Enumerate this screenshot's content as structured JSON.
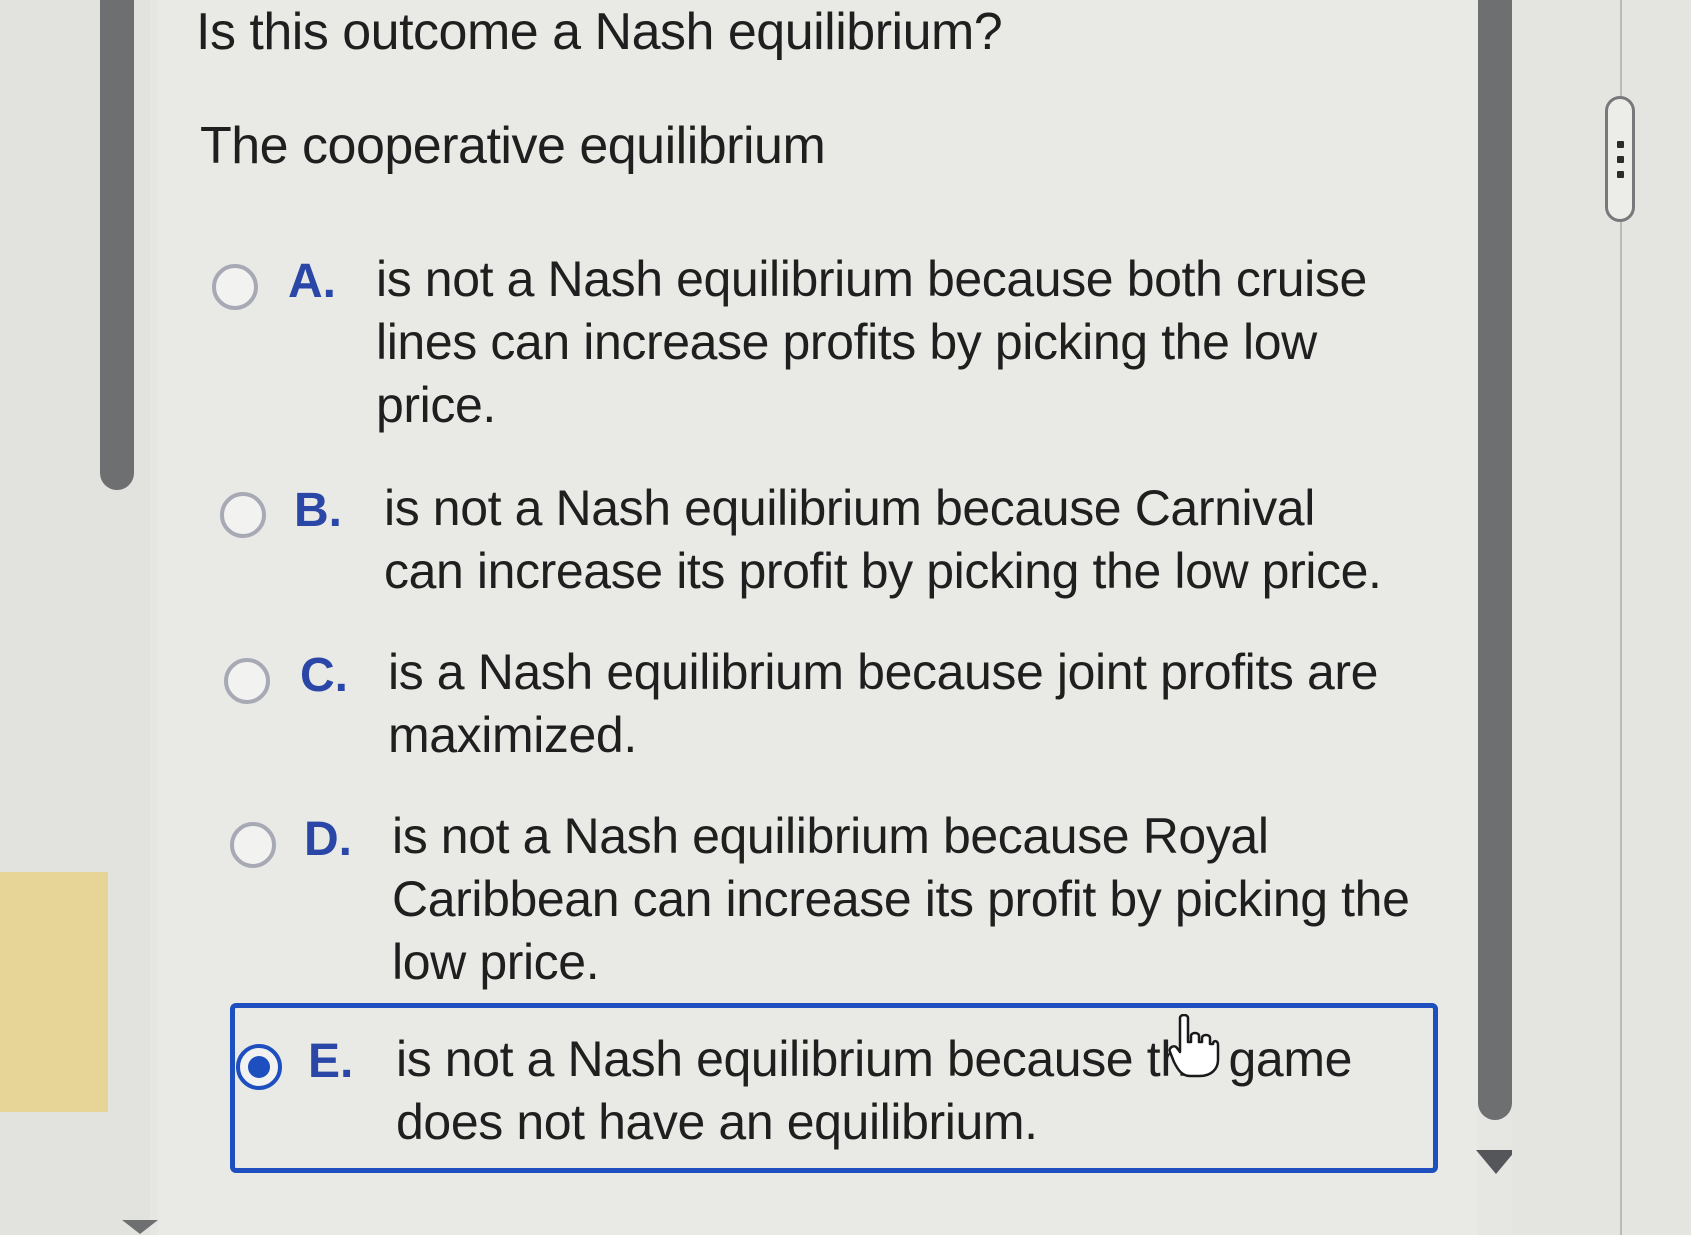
{
  "question": "Is this outcome a Nash equilibrium?",
  "prompt": "The cooperative equilibrium",
  "options": [
    {
      "letter": "A.",
      "text": "is not a Nash equilibrium because both cruise lines can increase profits by picking the low price.",
      "selected": false
    },
    {
      "letter": "B.",
      "text": "is not a Nash equilibrium because Carnival can increase its profit by picking the low price.",
      "selected": false
    },
    {
      "letter": "C.",
      "text": "is a Nash equilibrium because joint profits are maximized.",
      "selected": false
    },
    {
      "letter": "D.",
      "text": "is not a Nash equilibrium because Royal Caribbean can increase its profit by picking the low price.",
      "selected": false
    },
    {
      "letter": "E.",
      "text": "is not a Nash equilibrium because the game does not have an equilibrium.",
      "selected": true
    }
  ],
  "colors": {
    "accent": "#1e4fbf",
    "letter": "#2a47a8",
    "scrollbar": "#6e6f70"
  },
  "icons": {
    "panel_handle": "vertical-ellipsis-icon",
    "cursor": "hand-pointer-icon",
    "scroll_down": "triangle-down-icon"
  }
}
